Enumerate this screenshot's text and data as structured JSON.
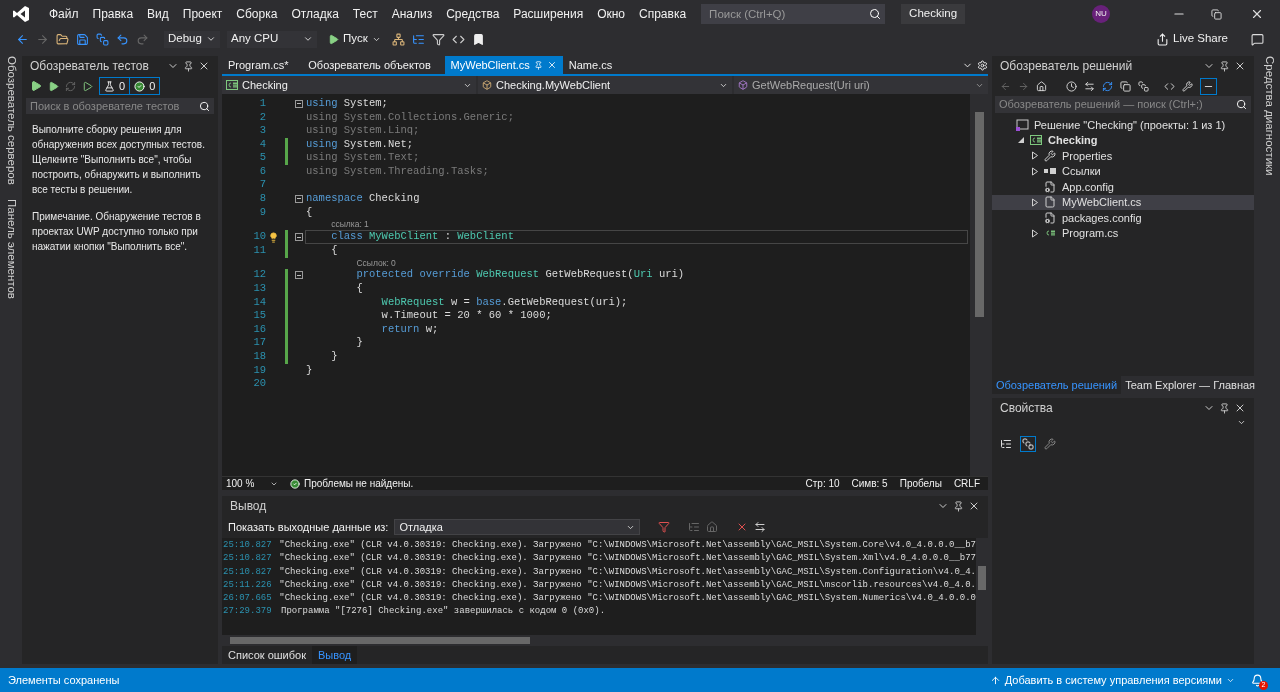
{
  "menu": [
    "Файл",
    "Правка",
    "Вид",
    "Проект",
    "Сборка",
    "Отладка",
    "Тест",
    "Анализ",
    "Средства",
    "Расширения",
    "Окно",
    "Справка"
  ],
  "search": {
    "placeholder": "Поиск (Ctrl+Q)"
  },
  "solution_badge": "Checking",
  "avatar": "NU",
  "toolbar": {
    "configuration": "Debug",
    "platform": "Any CPU",
    "start": "Пуск",
    "live_share": "Live Share"
  },
  "left_strip": [
    "Обозреватель серверов",
    "Панель элементов"
  ],
  "test_explorer": {
    "title": "Обозреватель тестов",
    "counts": [
      "0",
      "0"
    ],
    "search_placeholder": "Поиск в обозревателе тестов",
    "paragraphs": [
      "Выполните сборку решения для обнаружения всех доступных тестов. Щелкните \"Выполнить все\", чтобы построить, обнаружить и выполнить все тесты в решении.",
      "Примечание. Обнаружение тестов в проектах UWP доступно только при нажатии кнопки \"Выполнить все\"."
    ]
  },
  "editor_tabs": [
    {
      "label": "Program.cs*",
      "selected": false
    },
    {
      "label": "Обозреватель объектов",
      "selected": false
    },
    {
      "label": "MyWebClient.cs",
      "selected": true
    },
    {
      "label": "Name.cs",
      "selected": false
    }
  ],
  "nav_bar": [
    "Checking",
    "Checking.MyWebClient",
    "GetWebRequest(Uri uri)"
  ],
  "code": {
    "lines": [
      {
        "kind": "code",
        "number": "1",
        "fold": true,
        "changed": false,
        "current": false,
        "lightbulb": false,
        "tokens": [
          {
            "kind": "keyword",
            "text": "using"
          },
          {
            "kind": "plain",
            "text": " System;"
          }
        ]
      },
      {
        "kind": "code",
        "number": "2",
        "fold": false,
        "changed": false,
        "current": false,
        "lightbulb": false,
        "tokens": [
          {
            "kind": "unused",
            "text": "using System.Collections.Generic;"
          }
        ]
      },
      {
        "kind": "code",
        "number": "3",
        "fold": false,
        "changed": false,
        "current": false,
        "lightbulb": false,
        "tokens": [
          {
            "kind": "unused",
            "text": "using System.Linq;"
          }
        ]
      },
      {
        "kind": "code",
        "number": "4",
        "fold": false,
        "changed": true,
        "current": false,
        "lightbulb": false,
        "tokens": [
          {
            "kind": "keyword",
            "text": "using"
          },
          {
            "kind": "plain",
            "text": " System.Net;"
          }
        ]
      },
      {
        "kind": "code",
        "number": "5",
        "fold": false,
        "changed": true,
        "current": false,
        "lightbulb": false,
        "tokens": [
          {
            "kind": "unused",
            "text": "using System.Text;"
          }
        ]
      },
      {
        "kind": "code",
        "number": "6",
        "fold": false,
        "changed": false,
        "current": false,
        "lightbulb": false,
        "tokens": [
          {
            "kind": "unused",
            "text": "using System.Threading.Tasks;"
          }
        ]
      },
      {
        "kind": "code",
        "number": "7",
        "fold": false,
        "changed": false,
        "current": false,
        "lightbulb": false
      },
      {
        "kind": "code",
        "number": "8",
        "fold": true,
        "changed": false,
        "current": false,
        "lightbulb": false,
        "tokens": [
          {
            "kind": "keyword",
            "text": "namespace"
          },
          {
            "kind": "plain",
            "text": " Checking"
          }
        ]
      },
      {
        "kind": "code",
        "number": "9",
        "fold": false,
        "changed": false,
        "current": false,
        "lightbulb": false,
        "tokens": [
          {
            "kind": "plain",
            "text": "{"
          }
        ]
      },
      {
        "kind": "lens",
        "text": "ссылка: 1"
      },
      {
        "kind": "code",
        "number": "10",
        "fold": true,
        "changed": true,
        "current": true,
        "lightbulb": true,
        "tokens": [
          {
            "kind": "keyword",
            "text": "    class"
          },
          {
            "kind": "type",
            "text": " MyWebClient"
          },
          {
            "kind": "plain",
            "text": " : "
          },
          {
            "kind": "type",
            "text": "WebClient"
          }
        ]
      },
      {
        "kind": "code",
        "number": "11",
        "fold": false,
        "changed": true,
        "current": false,
        "lightbulb": false,
        "tokens": [
          {
            "kind": "plain",
            "text": "    {"
          }
        ]
      },
      {
        "kind": "lens",
        "text": "Ссылок: 0"
      },
      {
        "kind": "code",
        "number": "12",
        "fold": true,
        "changed": true,
        "current": false,
        "lightbulb": false,
        "tokens": [
          {
            "kind": "keyword",
            "text": "        protected"
          },
          {
            "kind": "keyword",
            "text": " override"
          },
          {
            "kind": "type",
            "text": " WebRequest"
          },
          {
            "kind": "plain",
            "text": " GetWebRequest("
          },
          {
            "kind": "type",
            "text": "Uri"
          },
          {
            "kind": "plain",
            "text": " uri)"
          }
        ]
      },
      {
        "kind": "code",
        "number": "13",
        "fold": false,
        "changed": true,
        "current": false,
        "lightbulb": false,
        "tokens": [
          {
            "kind": "plain",
            "text": "        {"
          }
        ]
      },
      {
        "kind": "code",
        "number": "14",
        "fold": false,
        "changed": true,
        "current": false,
        "lightbulb": false,
        "tokens": [
          {
            "kind": "type",
            "text": "            WebRequest"
          },
          {
            "kind": "plain",
            "text": " w = "
          },
          {
            "kind": "keyword",
            "text": "base"
          },
          {
            "kind": "plain",
            "text": ".GetWebRequest(uri);"
          }
        ]
      },
      {
        "kind": "code",
        "number": "15",
        "fold": false,
        "changed": true,
        "current": false,
        "lightbulb": false,
        "tokens": [
          {
            "kind": "plain",
            "text": "            w.Timeout = 20 * 60 * 1000;"
          }
        ]
      },
      {
        "kind": "code",
        "number": "16",
        "fold": false,
        "changed": true,
        "current": false,
        "lightbulb": false,
        "tokens": [
          {
            "kind": "keyword",
            "text": "            return"
          },
          {
            "kind": "plain",
            "text": " w;"
          }
        ]
      },
      {
        "kind": "code",
        "number": "17",
        "fold": false,
        "changed": true,
        "current": false,
        "lightbulb": false,
        "tokens": [
          {
            "kind": "plain",
            "text": "        }"
          }
        ]
      },
      {
        "kind": "code",
        "number": "18",
        "fold": false,
        "changed": true,
        "current": false,
        "lightbulb": false,
        "tokens": [
          {
            "kind": "plain",
            "text": "    }"
          }
        ]
      },
      {
        "kind": "code",
        "number": "19",
        "fold": false,
        "changed": false,
        "current": false,
        "lightbulb": false,
        "tokens": [
          {
            "kind": "plain",
            "text": "}"
          }
        ]
      },
      {
        "kind": "code",
        "number": "20",
        "fold": false,
        "changed": false,
        "current": false,
        "lightbulb": false
      }
    ]
  },
  "editor_status": {
    "zoom": "100 %",
    "issues": "Проблемы не найдены.",
    "line": "Стр: 10",
    "column": "Симв: 5",
    "indent": "Пробелы",
    "line_endings": "CRLF"
  },
  "output": {
    "title": "Вывод",
    "source_label": "Показать выходные данные из:",
    "source": "Отладка",
    "lines": [
      {
        "time": "25:10.827",
        "text": "\"Checking.exe\" (CLR v4.0.30319: Checking.exe). Загружено \"C:\\WINDOWS\\Microsoft.Net\\assembly\\GAC_MSIL\\System.Core\\v4.0_4.0.0.0__b7"
      },
      {
        "time": "25:10.827",
        "text": "\"Checking.exe\" (CLR v4.0.30319: Checking.exe). Загружено \"C:\\WINDOWS\\Microsoft.Net\\assembly\\GAC_MSIL\\System.Xml\\v4.0_4.0.0.0__b77"
      },
      {
        "time": "25:10.827",
        "text": "\"Checking.exe\" (CLR v4.0.30319: Checking.exe). Загружено \"C:\\WINDOWS\\Microsoft.Net\\assembly\\GAC_MSIL\\System.Configuration\\v4.0_4."
      },
      {
        "time": "25:11.226",
        "text": "\"Checking.exe\" (CLR v4.0.30319: Checking.exe). Загружено \"C:\\WINDOWS\\Microsoft.Net\\assembly\\GAC_MSIL\\mscorlib.resources\\v4.0_4.0."
      },
      {
        "time": "26:07.665",
        "text": "\"Checking.exe\" (CLR v4.0.30319: Checking.exe). Загружено \"C:\\WINDOWS\\Microsoft.Net\\assembly\\GAC_MSIL\\System.Numerics\\v4.0_4.0.0.0"
      },
      {
        "time": "27:29.379",
        "text": "Программа \"[7276] Checking.exe\" завершилась с кодом 0 (0x0)."
      }
    ]
  },
  "bottom_tabs": [
    {
      "label": "Список ошибок",
      "selected": false
    },
    {
      "label": "Вывод",
      "selected": true
    }
  ],
  "solution_explorer": {
    "title": "Обозреватель решений",
    "search_placeholder": "Обозреватель решений — поиск (Ctrl+;)",
    "tree": [
      {
        "label": "Решение \"Checking\" (проекты: 1 из 1)",
        "kind": "solution",
        "selected": false,
        "children": [
          {
            "label": "Checking",
            "kind": "project",
            "expanded": true,
            "selected": false,
            "children": [
              {
                "label": "Properties",
                "kind": "properties",
                "expanded": false,
                "selected": false
              },
              {
                "label": "Ссылки",
                "kind": "references",
                "expanded": false,
                "selected": false
              },
              {
                "label": "App.config",
                "kind": "config",
                "selected": false
              },
              {
                "label": "MyWebClient.cs",
                "kind": "file",
                "expanded": false,
                "selected": true
              },
              {
                "label": "packages.config",
                "kind": "config",
                "selected": false
              },
              {
                "label": "Program.cs",
                "kind": "csharp",
                "expanded": false,
                "selected": false
              }
            ]
          }
        ]
      }
    ],
    "tabs": [
      {
        "label": "Обозреватель решений",
        "selected": true
      },
      {
        "label": "Team Explorer — Главная",
        "selected": false
      }
    ]
  },
  "properties": {
    "title": "Свойства"
  },
  "right_strip": "Средства диагностики",
  "status_bar": {
    "message": "Элементы сохранены",
    "source_control": "Добавить в систему управления версиями",
    "notifications": "2"
  }
}
